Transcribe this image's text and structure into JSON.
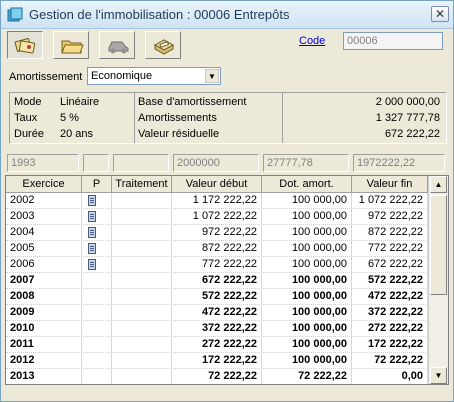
{
  "window": {
    "title": "Gestion de l'immobilisation : 00006 Entrepôts",
    "close_glyph": "✕"
  },
  "toolbar": {
    "buttons": [
      {
        "icon": "cards-icon",
        "name": "toolbar-button-1"
      },
      {
        "icon": "folder-icon",
        "name": "toolbar-button-2"
      },
      {
        "icon": "car-icon",
        "name": "toolbar-button-3"
      },
      {
        "icon": "card-box-icon",
        "name": "toolbar-button-4"
      }
    ],
    "code_label": "Code",
    "code_value": "00006"
  },
  "amortissement": {
    "label": "Amortissement",
    "selected": "Economique"
  },
  "info": {
    "mode_label": "Mode",
    "mode_value": "Linéaire",
    "taux_label": "Taux",
    "taux_value": "5 %",
    "duree_label": "Durée",
    "duree_value": "20 ans",
    "base_label": "Base d'amortissement",
    "base_value": "2 000 000,00",
    "amort_label": "Amortissements",
    "amort_value": "1 327 777,78",
    "residuelle_label": "Valeur résiduelle",
    "residuelle_value": "672 222,22"
  },
  "summary": {
    "c1": "1993",
    "c2": "",
    "c3": "",
    "c4": "2000000",
    "c5": "27777,78",
    "c6": "1972222,22"
  },
  "table": {
    "headers": {
      "exercice": "Exercice",
      "p": "P",
      "traitement": "Traitement",
      "debut": "Valeur début",
      "dot": "Dot. amort.",
      "fin": "Valeur fin"
    },
    "rows": [
      {
        "exercice": "2002",
        "p": true,
        "traitement": "",
        "debut": "1 172 222,22",
        "dot": "100 000,00",
        "fin": "1 072 222,22",
        "bold": false
      },
      {
        "exercice": "2003",
        "p": true,
        "traitement": "",
        "debut": "1 072 222,22",
        "dot": "100 000,00",
        "fin": "972 222,22",
        "bold": false
      },
      {
        "exercice": "2004",
        "p": true,
        "traitement": "",
        "debut": "972 222,22",
        "dot": "100 000,00",
        "fin": "872 222,22",
        "bold": false
      },
      {
        "exercice": "2005",
        "p": true,
        "traitement": "",
        "debut": "872 222,22",
        "dot": "100 000,00",
        "fin": "772 222,22",
        "bold": false
      },
      {
        "exercice": "2006",
        "p": true,
        "traitement": "",
        "debut": "772 222,22",
        "dot": "100 000,00",
        "fin": "672 222,22",
        "bold": false
      },
      {
        "exercice": "2007",
        "p": false,
        "traitement": "",
        "debut": "672 222,22",
        "dot": "100 000,00",
        "fin": "572 222,22",
        "bold": true
      },
      {
        "exercice": "2008",
        "p": false,
        "traitement": "",
        "debut": "572 222,22",
        "dot": "100 000,00",
        "fin": "472 222,22",
        "bold": true
      },
      {
        "exercice": "2009",
        "p": false,
        "traitement": "",
        "debut": "472 222,22",
        "dot": "100 000,00",
        "fin": "372 222,22",
        "bold": true
      },
      {
        "exercice": "2010",
        "p": false,
        "traitement": "",
        "debut": "372 222,22",
        "dot": "100 000,00",
        "fin": "272 222,22",
        "bold": true
      },
      {
        "exercice": "2011",
        "p": false,
        "traitement": "",
        "debut": "272 222,22",
        "dot": "100 000,00",
        "fin": "172 222,22",
        "bold": true
      },
      {
        "exercice": "2012",
        "p": false,
        "traitement": "",
        "debut": "172 222,22",
        "dot": "100 000,00",
        "fin": "72 222,22",
        "bold": true
      },
      {
        "exercice": "2013",
        "p": false,
        "traitement": "",
        "debut": "72 222,22",
        "dot": "72 222,22",
        "fin": "0,00",
        "bold": true
      }
    ]
  },
  "scrollbar": {
    "up_glyph": "▲",
    "down_glyph": "▼"
  },
  "select_arrow_glyph": "▼"
}
